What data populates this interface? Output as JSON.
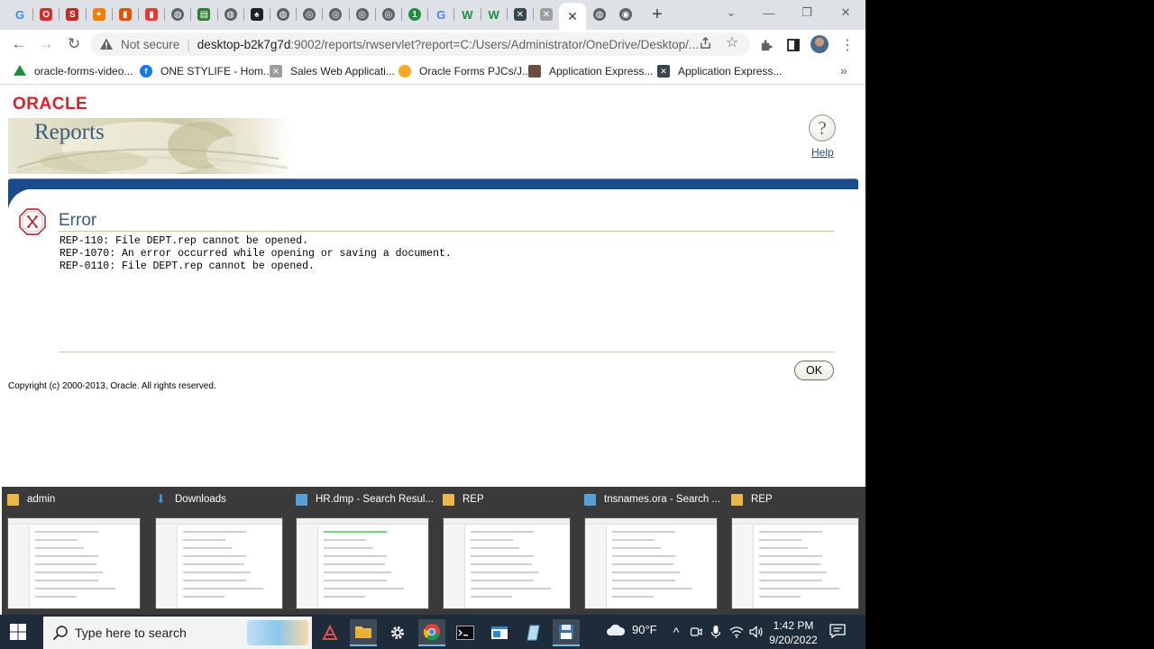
{
  "browser": {
    "tabs": [
      {
        "icon": "google-icon",
        "color": "#ffffff",
        "glyph": "G"
      },
      {
        "icon": "oracle-icon",
        "color": "#d32f2f",
        "glyph": "O"
      },
      {
        "icon": "s-app-icon",
        "color": "#c62828",
        "glyph": "S"
      },
      {
        "icon": "orange-app-icon",
        "color": "#f57c00",
        "glyph": "✦"
      },
      {
        "icon": "office-icon",
        "color": "#e65100",
        "glyph": "▮"
      },
      {
        "icon": "office-icon",
        "color": "#e53935",
        "glyph": "▮"
      },
      {
        "icon": "globe-icon",
        "color": "#5f6368",
        "glyph": "◍"
      },
      {
        "icon": "sheet-icon",
        "color": "#2e7d32",
        "glyph": "▤"
      },
      {
        "icon": "globe-icon",
        "color": "#5f6368",
        "glyph": "◍"
      },
      {
        "icon": "spade-icon",
        "color": "#202124",
        "glyph": "♠"
      },
      {
        "icon": "globe-icon",
        "color": "#5f6368",
        "glyph": "◍"
      },
      {
        "icon": "chrome-icon",
        "color": "#5f6368",
        "glyph": "◎"
      },
      {
        "icon": "chrome-icon",
        "color": "#5f6368",
        "glyph": "◎"
      },
      {
        "icon": "chrome-icon",
        "color": "#5f6368",
        "glyph": "◎"
      },
      {
        "icon": "chrome-icon",
        "color": "#5f6368",
        "glyph": "◎"
      },
      {
        "icon": "green-circle-icon",
        "color": "#1e8e3e",
        "glyph": "1"
      },
      {
        "icon": "google-icon",
        "color": "#ffffff",
        "glyph": "G"
      },
      {
        "icon": "w-icon",
        "color": "#ffffff",
        "glyph": "W"
      },
      {
        "icon": "w-icon",
        "color": "#ffffff",
        "glyph": "W"
      },
      {
        "icon": "apex-icon",
        "color": "#37474f",
        "glyph": "✕"
      },
      {
        "icon": "apex-icon",
        "color": "#9e9e9e",
        "glyph": "✕"
      }
    ],
    "tabs_after": [
      {
        "icon": "globe-icon",
        "color": "#5f6368",
        "glyph": "◍"
      },
      {
        "icon": "avatar-tab-icon",
        "color": "#5f6368",
        "glyph": "◉"
      }
    ],
    "active_tab_close": "✕",
    "new_tab": "+",
    "window_controls": {
      "dropdown": "⌄",
      "minimize": "—",
      "restore": "❐",
      "close": "✕"
    },
    "nav": {
      "back": "←",
      "forward": "→",
      "reload": "↻"
    },
    "security_label": "Not secure",
    "url_host": "desktop-b2k7g7d",
    "url_rest": ":9002/reports/rwservlet?report=C:/Users/Administrator/OneDrive/Desktop/...",
    "bookmarks": [
      {
        "label": "oracle-forms-video...",
        "icon": "drive-icon",
        "color": "#1e8e3e"
      },
      {
        "label": "ONE STYLIFE - Hom...",
        "icon": "facebook-icon",
        "color": "#1877f2"
      },
      {
        "label": "Sales Web Applicati...",
        "icon": "apex-icon",
        "color": "#9e9e9e"
      },
      {
        "label": "Oracle Forms PJCs/J...",
        "icon": "chat-icon",
        "color": "#f9a825"
      },
      {
        "label": "Application Express...",
        "icon": "app-icon",
        "color": "#6d4c41"
      },
      {
        "label": "Application Express...",
        "icon": "apex-icon",
        "color": "#37474f"
      }
    ],
    "bookmarks_more": "»"
  },
  "page": {
    "logo": "ORACLE",
    "product": "Reports",
    "help_glyph": "?",
    "help_label": "Help",
    "error_title": "Error",
    "error_lines": [
      "REP-110: File DEPT.rep cannot be opened.",
      "REP-1070: An error occurred while opening or saving a document.",
      "REP-0110: File DEPT.rep cannot be opened."
    ],
    "ok_label": "OK",
    "copyright": "Copyright (c) 2000-2013, Oracle. All rights reserved.",
    "colors": {
      "oracle_red": "#e01f26",
      "banner_blue": "#1a4b8c",
      "title_blue": "#3c5c7e"
    }
  },
  "previews": [
    {
      "title": "admin",
      "icon": "folder-icon"
    },
    {
      "title": "Downloads",
      "icon": "download-icon"
    },
    {
      "title": "HR.dmp - Search Resul...",
      "icon": "search-results-icon"
    },
    {
      "title": "REP",
      "icon": "folder-icon"
    },
    {
      "title": "tnsnames.ora - Search ...",
      "icon": "search-results-icon"
    },
    {
      "title": "REP",
      "icon": "folder-icon"
    }
  ],
  "taskbar": {
    "search_placeholder": "Type here to search",
    "temperature": "90°F",
    "time": "1:42 PM",
    "date": "9/20/2022",
    "tray_chevron": "^"
  }
}
